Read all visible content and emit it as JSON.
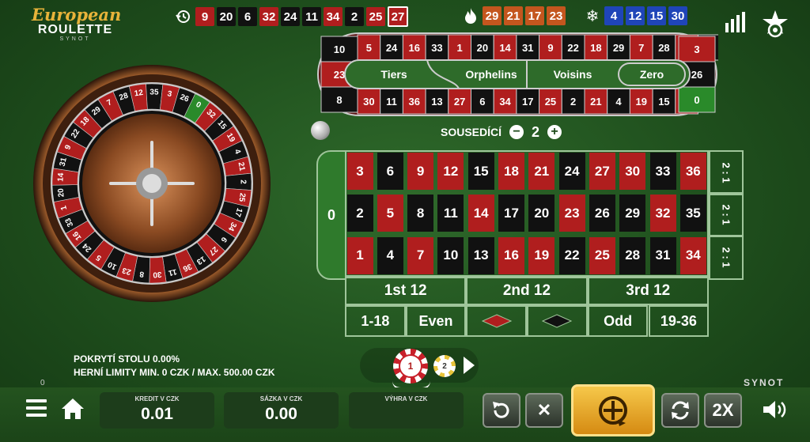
{
  "logo": {
    "line1": "European",
    "line2": "ROULETTE",
    "line3": "SYNOT"
  },
  "history": {
    "icon": "history-icon",
    "numbers": [
      {
        "n": "9",
        "c": "r"
      },
      {
        "n": "20",
        "c": "b"
      },
      {
        "n": "6",
        "c": "b"
      },
      {
        "n": "32",
        "c": "r"
      },
      {
        "n": "24",
        "c": "b"
      },
      {
        "n": "11",
        "c": "b"
      },
      {
        "n": "34",
        "c": "r"
      },
      {
        "n": "2",
        "c": "b"
      },
      {
        "n": "25",
        "c": "r"
      },
      {
        "n": "27",
        "c": "r"
      }
    ]
  },
  "hot": {
    "icon": "fire-icon",
    "numbers": [
      "29",
      "21",
      "17",
      "23"
    ]
  },
  "cold": {
    "icon": "snowflake-icon",
    "numbers": [
      "4",
      "12",
      "15",
      "30"
    ]
  },
  "racetrack": {
    "top": [
      "5",
      "24",
      "16",
      "33",
      "1",
      "20",
      "14",
      "31",
      "9",
      "22",
      "18",
      "29",
      "7",
      "28",
      "12",
      "35"
    ],
    "bottom": [
      "30",
      "11",
      "36",
      "13",
      "27",
      "6",
      "34",
      "17",
      "25",
      "2",
      "21",
      "4",
      "19",
      "15",
      "32"
    ],
    "left": [
      "10",
      "23",
      "8"
    ],
    "right": [
      "3",
      "26",
      "0"
    ],
    "sections": [
      "Tiers",
      "Orphelins",
      "Voisins",
      "Zero"
    ]
  },
  "neighbours": {
    "label": "SOUSEDÍCÍ",
    "minus": "−",
    "value": "2",
    "plus": "+"
  },
  "table": {
    "zero": "0",
    "rows": [
      [
        "3",
        "6",
        "9",
        "12",
        "15",
        "18",
        "21",
        "24",
        "27",
        "30",
        "33",
        "36"
      ],
      [
        "2",
        "5",
        "8",
        "11",
        "14",
        "17",
        "20",
        "23",
        "26",
        "29",
        "32",
        "35"
      ],
      [
        "1",
        "4",
        "7",
        "10",
        "13",
        "16",
        "19",
        "22",
        "25",
        "28",
        "31",
        "34"
      ]
    ],
    "column_bet": "2 : 1",
    "dozens": [
      "1st 12",
      "2nd 12",
      "3rd 12"
    ],
    "outside": [
      "1-18",
      "Even",
      "",
      "",
      "Odd",
      "19-36"
    ]
  },
  "info": {
    "coverage": "POKRYTÍ STOLU 0.00%",
    "limits": "HERNÍ LIMITY MIN. 0 CZK / MAX. 500.00 CZK",
    "small_zero": "0"
  },
  "chips": {
    "selected": "1",
    "next": "2"
  },
  "brand": "SYNOT",
  "panels": {
    "credit_label": "KREDIT V CZK",
    "credit": "0.01",
    "bet_label": "SÁZKA V CZK",
    "bet": "0.00",
    "win_label": "VÝHRA V CZK",
    "win": ""
  },
  "buttons": {
    "double": "2X",
    "clear": "✕"
  },
  "colors": {
    "felt": "#24531f",
    "red": "#b01e1e",
    "black": "#111111",
    "gold": "#e8b33a"
  }
}
